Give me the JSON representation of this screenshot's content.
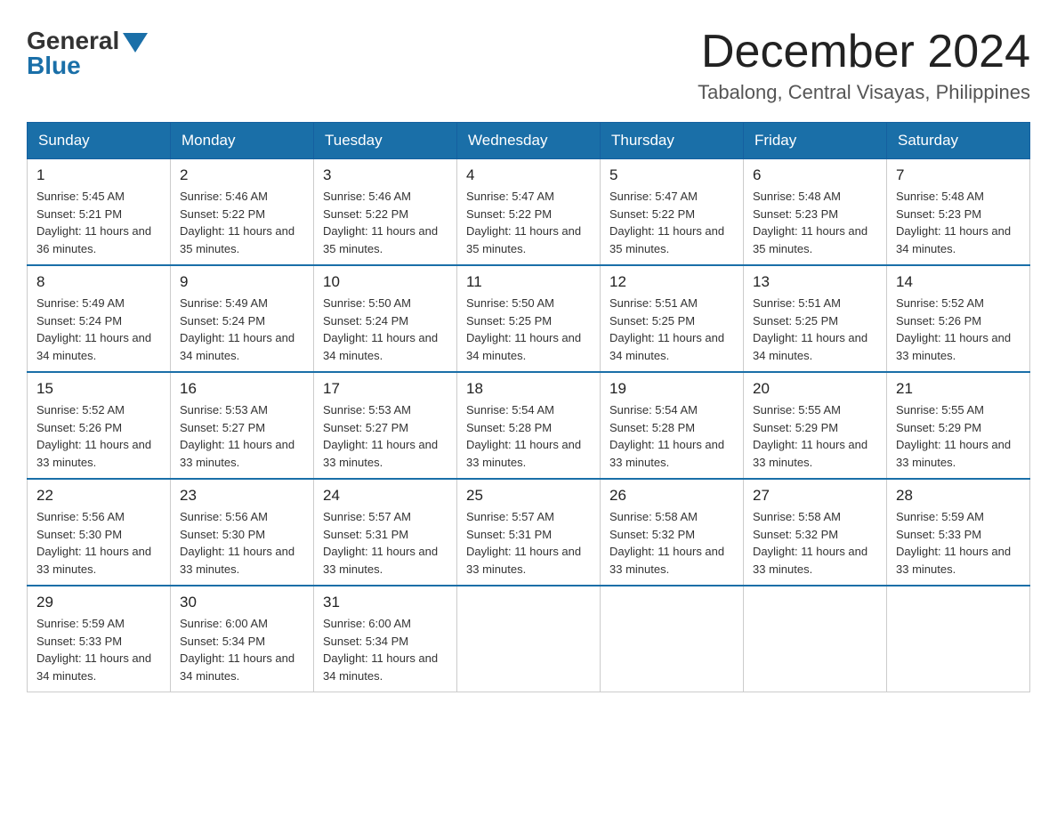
{
  "logo": {
    "general": "General",
    "blue": "Blue"
  },
  "header": {
    "month": "December 2024",
    "location": "Tabalong, Central Visayas, Philippines"
  },
  "weekdays": [
    "Sunday",
    "Monday",
    "Tuesday",
    "Wednesday",
    "Thursday",
    "Friday",
    "Saturday"
  ],
  "weeks": [
    [
      {
        "day": "1",
        "sunrise": "Sunrise: 5:45 AM",
        "sunset": "Sunset: 5:21 PM",
        "daylight": "Daylight: 11 hours and 36 minutes."
      },
      {
        "day": "2",
        "sunrise": "Sunrise: 5:46 AM",
        "sunset": "Sunset: 5:22 PM",
        "daylight": "Daylight: 11 hours and 35 minutes."
      },
      {
        "day": "3",
        "sunrise": "Sunrise: 5:46 AM",
        "sunset": "Sunset: 5:22 PM",
        "daylight": "Daylight: 11 hours and 35 minutes."
      },
      {
        "day": "4",
        "sunrise": "Sunrise: 5:47 AM",
        "sunset": "Sunset: 5:22 PM",
        "daylight": "Daylight: 11 hours and 35 minutes."
      },
      {
        "day": "5",
        "sunrise": "Sunrise: 5:47 AM",
        "sunset": "Sunset: 5:22 PM",
        "daylight": "Daylight: 11 hours and 35 minutes."
      },
      {
        "day": "6",
        "sunrise": "Sunrise: 5:48 AM",
        "sunset": "Sunset: 5:23 PM",
        "daylight": "Daylight: 11 hours and 35 minutes."
      },
      {
        "day": "7",
        "sunrise": "Sunrise: 5:48 AM",
        "sunset": "Sunset: 5:23 PM",
        "daylight": "Daylight: 11 hours and 34 minutes."
      }
    ],
    [
      {
        "day": "8",
        "sunrise": "Sunrise: 5:49 AM",
        "sunset": "Sunset: 5:24 PM",
        "daylight": "Daylight: 11 hours and 34 minutes."
      },
      {
        "day": "9",
        "sunrise": "Sunrise: 5:49 AM",
        "sunset": "Sunset: 5:24 PM",
        "daylight": "Daylight: 11 hours and 34 minutes."
      },
      {
        "day": "10",
        "sunrise": "Sunrise: 5:50 AM",
        "sunset": "Sunset: 5:24 PM",
        "daylight": "Daylight: 11 hours and 34 minutes."
      },
      {
        "day": "11",
        "sunrise": "Sunrise: 5:50 AM",
        "sunset": "Sunset: 5:25 PM",
        "daylight": "Daylight: 11 hours and 34 minutes."
      },
      {
        "day": "12",
        "sunrise": "Sunrise: 5:51 AM",
        "sunset": "Sunset: 5:25 PM",
        "daylight": "Daylight: 11 hours and 34 minutes."
      },
      {
        "day": "13",
        "sunrise": "Sunrise: 5:51 AM",
        "sunset": "Sunset: 5:25 PM",
        "daylight": "Daylight: 11 hours and 34 minutes."
      },
      {
        "day": "14",
        "sunrise": "Sunrise: 5:52 AM",
        "sunset": "Sunset: 5:26 PM",
        "daylight": "Daylight: 11 hours and 33 minutes."
      }
    ],
    [
      {
        "day": "15",
        "sunrise": "Sunrise: 5:52 AM",
        "sunset": "Sunset: 5:26 PM",
        "daylight": "Daylight: 11 hours and 33 minutes."
      },
      {
        "day": "16",
        "sunrise": "Sunrise: 5:53 AM",
        "sunset": "Sunset: 5:27 PM",
        "daylight": "Daylight: 11 hours and 33 minutes."
      },
      {
        "day": "17",
        "sunrise": "Sunrise: 5:53 AM",
        "sunset": "Sunset: 5:27 PM",
        "daylight": "Daylight: 11 hours and 33 minutes."
      },
      {
        "day": "18",
        "sunrise": "Sunrise: 5:54 AM",
        "sunset": "Sunset: 5:28 PM",
        "daylight": "Daylight: 11 hours and 33 minutes."
      },
      {
        "day": "19",
        "sunrise": "Sunrise: 5:54 AM",
        "sunset": "Sunset: 5:28 PM",
        "daylight": "Daylight: 11 hours and 33 minutes."
      },
      {
        "day": "20",
        "sunrise": "Sunrise: 5:55 AM",
        "sunset": "Sunset: 5:29 PM",
        "daylight": "Daylight: 11 hours and 33 minutes."
      },
      {
        "day": "21",
        "sunrise": "Sunrise: 5:55 AM",
        "sunset": "Sunset: 5:29 PM",
        "daylight": "Daylight: 11 hours and 33 minutes."
      }
    ],
    [
      {
        "day": "22",
        "sunrise": "Sunrise: 5:56 AM",
        "sunset": "Sunset: 5:30 PM",
        "daylight": "Daylight: 11 hours and 33 minutes."
      },
      {
        "day": "23",
        "sunrise": "Sunrise: 5:56 AM",
        "sunset": "Sunset: 5:30 PM",
        "daylight": "Daylight: 11 hours and 33 minutes."
      },
      {
        "day": "24",
        "sunrise": "Sunrise: 5:57 AM",
        "sunset": "Sunset: 5:31 PM",
        "daylight": "Daylight: 11 hours and 33 minutes."
      },
      {
        "day": "25",
        "sunrise": "Sunrise: 5:57 AM",
        "sunset": "Sunset: 5:31 PM",
        "daylight": "Daylight: 11 hours and 33 minutes."
      },
      {
        "day": "26",
        "sunrise": "Sunrise: 5:58 AM",
        "sunset": "Sunset: 5:32 PM",
        "daylight": "Daylight: 11 hours and 33 minutes."
      },
      {
        "day": "27",
        "sunrise": "Sunrise: 5:58 AM",
        "sunset": "Sunset: 5:32 PM",
        "daylight": "Daylight: 11 hours and 33 minutes."
      },
      {
        "day": "28",
        "sunrise": "Sunrise: 5:59 AM",
        "sunset": "Sunset: 5:33 PM",
        "daylight": "Daylight: 11 hours and 33 minutes."
      }
    ],
    [
      {
        "day": "29",
        "sunrise": "Sunrise: 5:59 AM",
        "sunset": "Sunset: 5:33 PM",
        "daylight": "Daylight: 11 hours and 34 minutes."
      },
      {
        "day": "30",
        "sunrise": "Sunrise: 6:00 AM",
        "sunset": "Sunset: 5:34 PM",
        "daylight": "Daylight: 11 hours and 34 minutes."
      },
      {
        "day": "31",
        "sunrise": "Sunrise: 6:00 AM",
        "sunset": "Sunset: 5:34 PM",
        "daylight": "Daylight: 11 hours and 34 minutes."
      },
      null,
      null,
      null,
      null
    ]
  ]
}
